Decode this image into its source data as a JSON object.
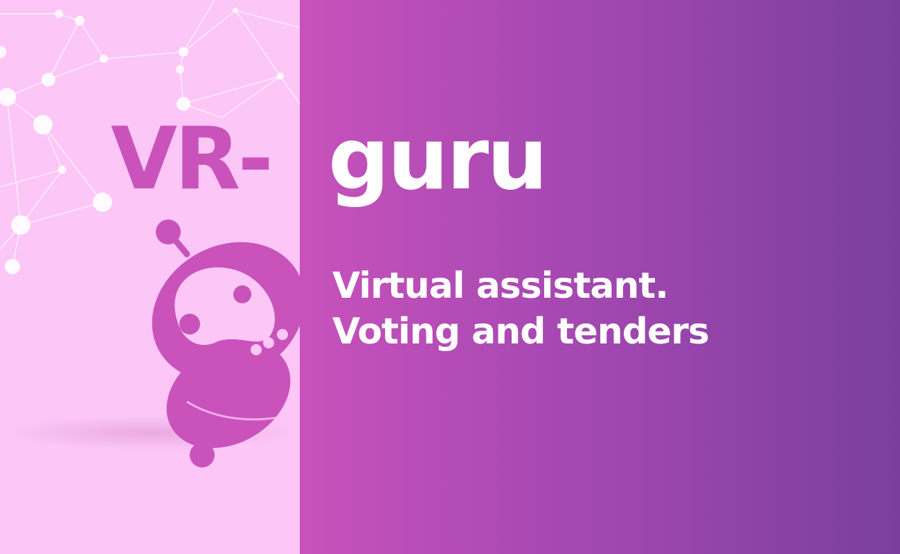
{
  "brand": {
    "prefix": "VR-",
    "name": "guru"
  },
  "subtitle": {
    "line1": "Virtual assistant.",
    "line2": "Voting and tenders"
  },
  "colors": {
    "left_bg": "#fcc6f6",
    "accent": "#c953bb",
    "gradient_start": "#c852bb",
    "gradient_end": "#7a3f9d",
    "text_light": "#ffffff"
  }
}
